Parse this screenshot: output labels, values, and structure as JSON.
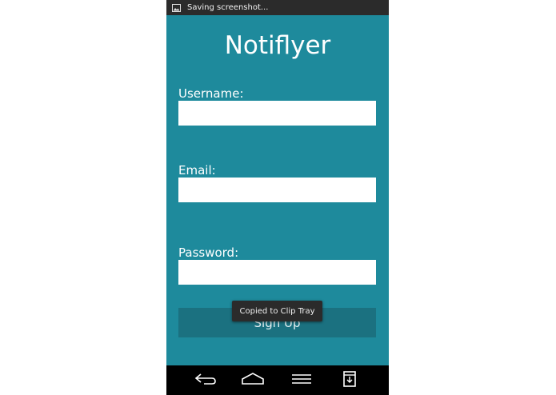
{
  "status_bar": {
    "notification_text": "Saving screenshot...",
    "icon": "image-icon"
  },
  "app": {
    "title": "Notiflyer"
  },
  "form": {
    "username": {
      "label": "Username:",
      "value": "",
      "placeholder": ""
    },
    "email": {
      "label": "Email:",
      "value": "",
      "placeholder": ""
    },
    "password": {
      "label": "Password:",
      "value": "",
      "placeholder": ""
    },
    "submit_label": "Sign Up"
  },
  "toast": {
    "text": "Copied to Clip Tray"
  },
  "nav_bar": {
    "buttons": [
      "back-icon",
      "home-icon",
      "menu-icon",
      "clip-tray-icon"
    ]
  },
  "colors": {
    "app_background": "#1e8a9c",
    "button_background": "#1b7180",
    "status_bar": "#2b2b2b",
    "nav_bar": "#000000"
  }
}
